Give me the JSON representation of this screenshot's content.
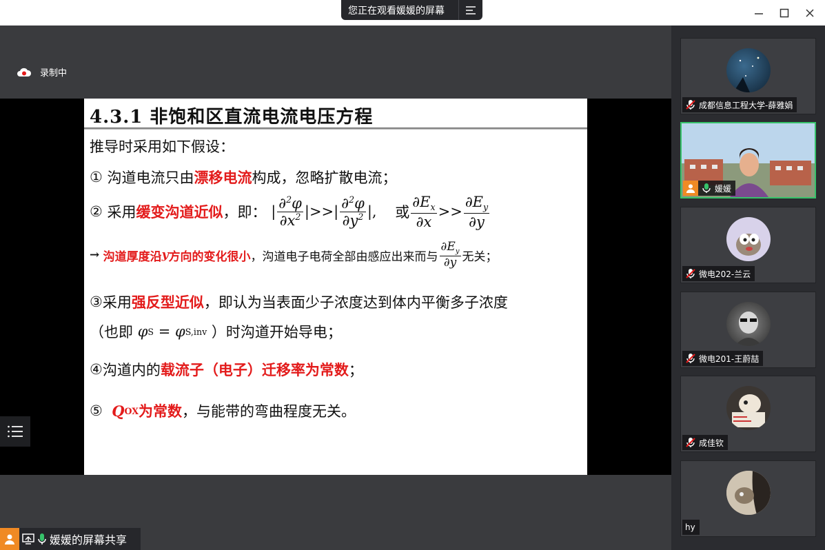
{
  "window": {
    "share_status": "您正在观看媛媛的屏幕"
  },
  "recording": {
    "label": "录制中"
  },
  "slide": {
    "title": "4.3.1 非饱和区直流电流电压方程",
    "intro": "推导时采用如下假设：",
    "item1": {
      "num": "①",
      "pre": "沟道电流只由",
      "red": "漂移电流",
      "post": "构成，忽略扩散电流；"
    },
    "item2": {
      "num": "②",
      "pre": "采用",
      "red": "缓变沟道近似",
      "post": "，即：",
      "gg": ">>",
      "phi": "φ",
      "x": "x",
      "y": "y",
      "sq": "2",
      "d": "∂",
      "comma": ",",
      "or": "或",
      "E": "E"
    },
    "item2b": {
      "arrow": "→",
      "red_a": "沟道厚度沿",
      "red_y": "y",
      "red_b": "方向的变化很小",
      "post_a": "，沟道电子电荷全部由感应出来而与",
      "post_b": "无关；"
    },
    "item3": {
      "num": "③",
      "pre": "采用",
      "red": "强反型近似",
      "post": "，即认为当表面少子浓度达到体内平衡多子浓度"
    },
    "item3b": {
      "open": "（也即",
      "phi": "φ",
      "sub_s": "S",
      "eq": "=",
      "sub_inv": "S,inv",
      "close": "）时沟道开始导电；"
    },
    "item4": {
      "num": "④",
      "pre": "沟道内的",
      "red": "载流子（电子）迁移率为常数",
      "post": "；"
    },
    "item5": {
      "num": "⑤",
      "q": "Q",
      "q_sub": "OX",
      "red": "为常数",
      "post": "，与能带的弯曲程度无关。"
    }
  },
  "bottom_bar": {
    "label": "媛媛的屏幕共享"
  },
  "participants": [
    {
      "name": "成都信息工程大学-薛雅娟",
      "muted": true
    },
    {
      "name": "媛媛",
      "muted": false,
      "speaking": true
    },
    {
      "name": "微电202-兰云",
      "muted": true
    },
    {
      "name": "微电201-王蔚喆",
      "muted": true
    },
    {
      "name": "成佳钦",
      "muted": true
    },
    {
      "name": "hy",
      "muted": true
    }
  ],
  "colors": {
    "accent_red": "#e31b1b",
    "active_border": "#36c26a",
    "host_orange": "#f08a24"
  }
}
